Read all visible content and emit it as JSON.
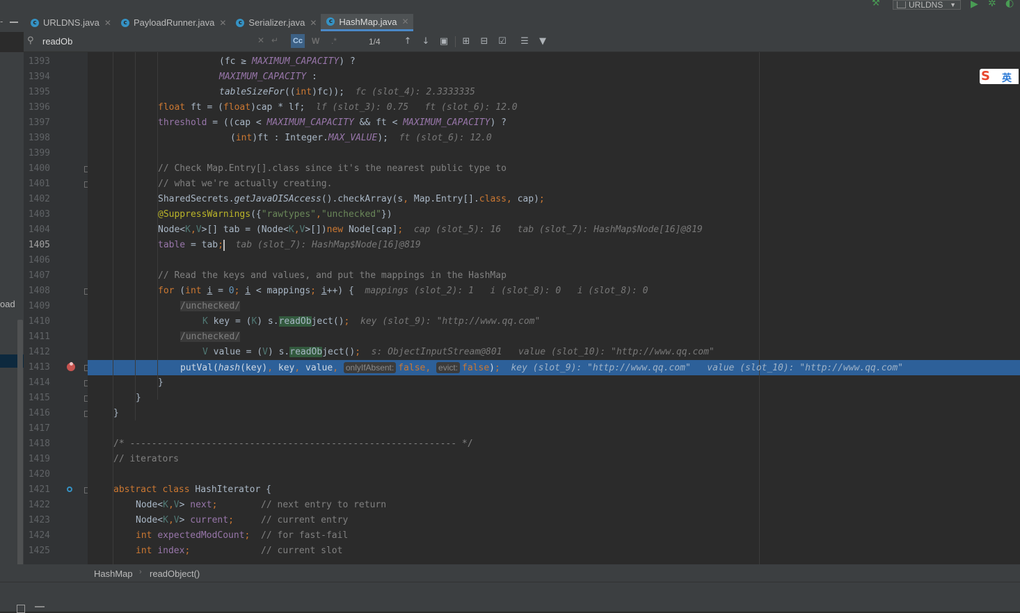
{
  "tabs": [
    {
      "label": "URLDNS.java",
      "icon": "class-icon"
    },
    {
      "label": "PayloadRunner.java",
      "icon": "class-icon"
    },
    {
      "label": "Serializer.java",
      "icon": "class-icon"
    },
    {
      "label": "HashMap.java",
      "icon": "class-icon",
      "active": true
    }
  ],
  "run_config": {
    "label": "URLDNS"
  },
  "find": {
    "query": "readOb",
    "match_counter": "1/4",
    "case_label": "Cc",
    "word_label": "W",
    "regex_label": ".*"
  },
  "left_cut_text": "oad",
  "ime": {
    "label": "英"
  },
  "breadcrumb": {
    "class_name": "HashMap",
    "method_name": "readObject()"
  },
  "lines": {
    "1393": "1393",
    "1394": "1394",
    "1395": "1395",
    "1396": "1396",
    "1397": "1397",
    "1398": "1398",
    "1399": "1399",
    "1400": "1400",
    "1401": "1401",
    "1402": "1402",
    "1403": "1403",
    "1404": "1404",
    "1405": "1405",
    "1406": "1406",
    "1407": "1407",
    "1408": "1408",
    "1409": "1409",
    "1410": "1410",
    "1411": "1411",
    "1412": "1412",
    "1413": "1413",
    "1414": "1414",
    "1415": "1415",
    "1416": "1416",
    "1417": "1417",
    "1418": "1418",
    "1419": "1419",
    "1420": "1420",
    "1421": "1421",
    "1422": "1422",
    "1423": "1423",
    "1424": "1424",
    "1425": "1425"
  },
  "hints": {
    "l1395": "fc (slot_4): 2.3333335",
    "l1396a": "lf (slot_3): 0.75",
    "l1396b": "ft (slot_6): 12.0",
    "l1398": "ft (slot_6): 12.0",
    "l1404a": "cap (slot_5): 16",
    "l1404b": "tab (slot_7): HashMap$Node[16]@819",
    "l1405": "tab (slot_7): HashMap$Node[16]@819",
    "l1408a": "mappings (slot_2): 1",
    "l1408b": "i (slot_8): 0",
    "l1408c": "i (slot_8): 0",
    "l1410": "key (slot_9): \"http://www.qq.com\"",
    "l1412a": "s: ObjectInputStream@801",
    "l1412b": "value (slot_10): \"http://www.qq.com\"",
    "l1413a": "key (slot_9): \"http://www.qq.com\"",
    "l1413b": "value (slot_10): \"http://www.qq.com\"",
    "p_onlyIfAbsent": "onlyIfAbsent:",
    "p_evict": "evict:"
  },
  "colors": {
    "accent": "#4a88c7",
    "execution_line": "#2d6099",
    "breakpoint": "#c75450"
  }
}
